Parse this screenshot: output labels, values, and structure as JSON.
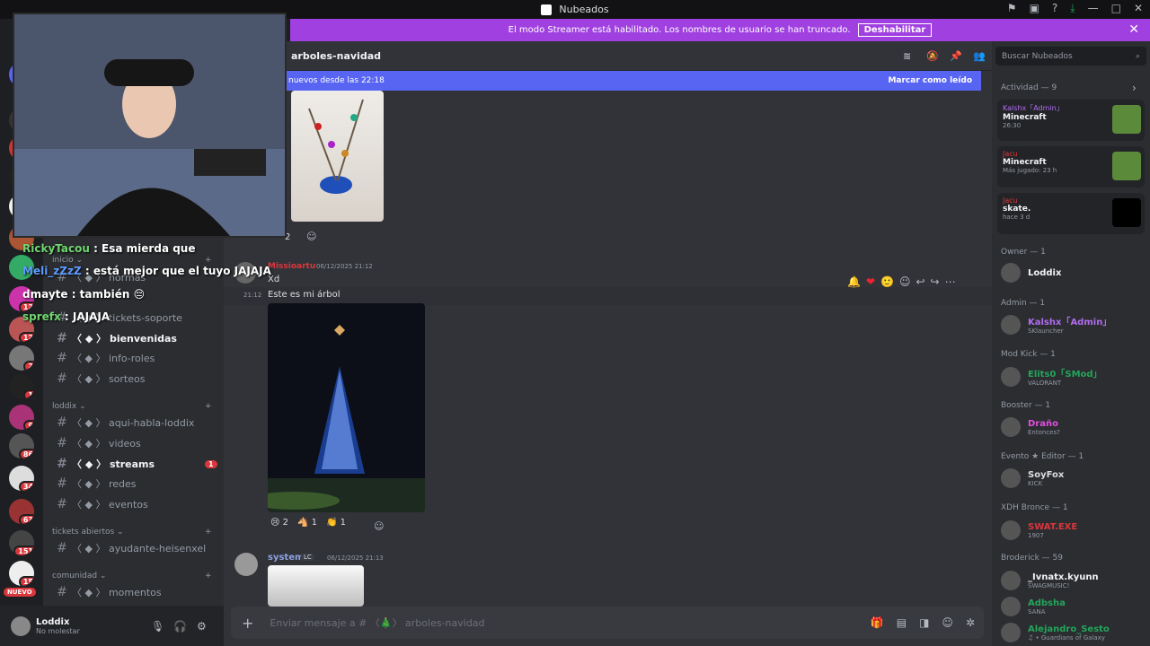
{
  "window": {
    "title": "Nubeados"
  },
  "banner": {
    "text": "El modo Streamer está habilitado. Los nombres de usuario se han truncado.",
    "button": "Deshabilitar"
  },
  "channel": {
    "name": "arboles-navidad",
    "new_since": "nuevos desde las 22:18",
    "mark_read": "Marcar como leído"
  },
  "server_badges": [
    "12",
    "12",
    "2",
    "1",
    "9",
    "86",
    "34",
    "63",
    "151",
    "15"
  ],
  "new_label": "NUEVO",
  "channels": {
    "top": [
      {
        "label": "inicio",
        "type": "cat"
      },
      {
        "label": "normas"
      },
      {
        "label": "tickets-soporte"
      },
      {
        "label": "bienvenidas",
        "active": true
      },
      {
        "label": "info-roles"
      },
      {
        "label": "sorteos"
      }
    ],
    "cat_loddix": "loddix",
    "loddix": [
      {
        "label": "aqui-habla-loddix"
      },
      {
        "label": "videos"
      },
      {
        "label": "streams",
        "active": true,
        "badge": "1"
      },
      {
        "label": "redes"
      },
      {
        "label": "eventos"
      }
    ],
    "cat_tickets": "tickets abiertos",
    "tickets": [
      {
        "label": "ayudante-heisenxel"
      }
    ],
    "cat_comunidad": "comunidad",
    "comunidad": [
      {
        "label": "momentos"
      }
    ]
  },
  "user": {
    "name": "Loddix",
    "status": "No molestar"
  },
  "messages": [
    {
      "author": "Missioartu",
      "time": "06/12/2025 21:12",
      "lines": [
        "Xd"
      ],
      "time2": "21:12",
      "line2": "Este es mi árbol",
      "reactions": [
        {
          "emoji": "😢",
          "count": "2"
        },
        {
          "emoji": "🐴",
          "count": "1"
        },
        {
          "emoji": "👏",
          "count": "1"
        }
      ]
    },
    {
      "author": "system",
      "tag": "LC",
      "time": "06/12/2025 21:13"
    }
  ],
  "reaction_top": "2",
  "composer": {
    "placeholder": "Enviar mensaje a # 〈🎄〉 arboles-navidad"
  },
  "members": {
    "search": "Buscar Nubeados",
    "activity_title": "Actividad — 9",
    "activity": [
      {
        "name": "Kalshx「Admin」",
        "game": "Minecraft",
        "time": "26:30"
      },
      {
        "name": "Jacu",
        "game": "Minecraft",
        "time": "Más jugado: 23 h"
      },
      {
        "name": "Jacu",
        "game": "skate.",
        "time": "hace 3 d"
      }
    ],
    "groups": [
      {
        "title": "Owner — 1",
        "members": [
          {
            "name": "Loddix",
            "status": ""
          }
        ]
      },
      {
        "title": "Admin — 1",
        "members": [
          {
            "name": "Kalshx「Admin」",
            "status": "SKlauncher"
          }
        ]
      },
      {
        "title": "Mod Kick — 1",
        "members": [
          {
            "name": "Elits0「SMod」",
            "status": "VALORANT"
          }
        ]
      },
      {
        "title": "Booster — 1",
        "members": [
          {
            "name": "Draño",
            "status": "Entonces?"
          }
        ]
      },
      {
        "title": "Evento ★ Editor — 1",
        "members": [
          {
            "name": "SoyFox",
            "status": "KICK"
          }
        ]
      },
      {
        "title": "XDH Bronce — 1",
        "members": [
          {
            "name": "SWAT.EXE",
            "status": "1907"
          }
        ]
      },
      {
        "title": "Broderick — 59",
        "members": [
          {
            "name": "_Ivnatx.kyunn",
            "status": "SWAGMUSIC!"
          },
          {
            "name": "Adbsha",
            "status": "SANA"
          },
          {
            "name": "Alejandro_Sesto",
            "status": "♫ • Guardians of Galaxy"
          }
        ]
      }
    ]
  },
  "overlay_chat": [
    {
      "user": "RickyTacou",
      "text": ": Esa mierda que",
      "color": "#6fd66f"
    },
    {
      "user": "Meli_zZzZ",
      "text": ": está mejor que el tuyo JAJAJA",
      "color": "#5f9cff"
    },
    {
      "user": "dmayte",
      "text": ": también 😔",
      "color": "#ffffff"
    },
    {
      "user": "sprefx",
      "text": ": JAJAJA",
      "color": "#6fd66f"
    }
  ],
  "colors": {
    "accent": "#5865f2",
    "banner": "#a040e0",
    "danger": "#da373c"
  }
}
